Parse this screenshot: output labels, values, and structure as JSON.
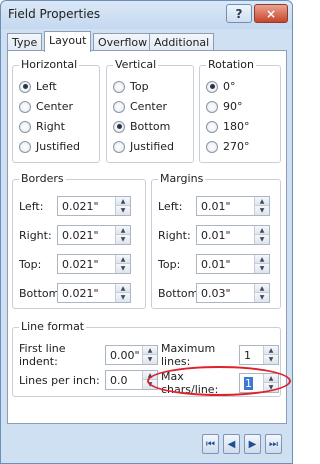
{
  "window": {
    "title": "Field Properties",
    "help_label": "?",
    "close_label": "×"
  },
  "tabs": [
    {
      "label": "Type"
    },
    {
      "label": "Layout",
      "active": true
    },
    {
      "label": "Overflow"
    },
    {
      "label": "Additional"
    }
  ],
  "horizontal": {
    "title": "Horizontal",
    "options": [
      {
        "label": "Left",
        "checked": true
      },
      {
        "label": "Center"
      },
      {
        "label": "Right"
      },
      {
        "label": "Justified"
      }
    ]
  },
  "vertical": {
    "title": "Vertical",
    "options": [
      {
        "label": "Top"
      },
      {
        "label": "Center"
      },
      {
        "label": "Bottom",
        "checked": true
      },
      {
        "label": "Justified"
      }
    ]
  },
  "rotation": {
    "title": "Rotation",
    "options": [
      {
        "label": "0°",
        "checked": true
      },
      {
        "label": "90°"
      },
      {
        "label": "180°"
      },
      {
        "label": "270°"
      }
    ]
  },
  "borders": {
    "title": "Borders",
    "fields": [
      {
        "label": "Left:",
        "value": "0.021\""
      },
      {
        "label": "Right:",
        "value": "0.021\""
      },
      {
        "label": "Top:",
        "value": "0.021\""
      },
      {
        "label": "Bottom:",
        "value": "0.021\""
      }
    ]
  },
  "margins": {
    "title": "Margins",
    "fields": [
      {
        "label": "Left:",
        "value": "0.01\""
      },
      {
        "label": "Right:",
        "value": "0.01\""
      },
      {
        "label": "Top:",
        "value": "0.01\""
      },
      {
        "label": "Bottom:",
        "value": "0.03\""
      }
    ]
  },
  "line_format": {
    "title": "Line format",
    "first_line_indent": {
      "label": "First line indent:",
      "value": "0.00\""
    },
    "maximum_lines": {
      "label": "Maximum lines:",
      "value": "1"
    },
    "lines_per_inch": {
      "label": "Lines per inch:",
      "value": "0.0"
    },
    "max_chars_line": {
      "label": "Max chars/line:",
      "value": "1"
    }
  },
  "nav": {
    "first": "⏮",
    "prev": "◀",
    "next": "▶",
    "last": "⏭"
  },
  "colors": {
    "highlight": "#e0202a",
    "nav_arrow": "#1d4f9a"
  }
}
